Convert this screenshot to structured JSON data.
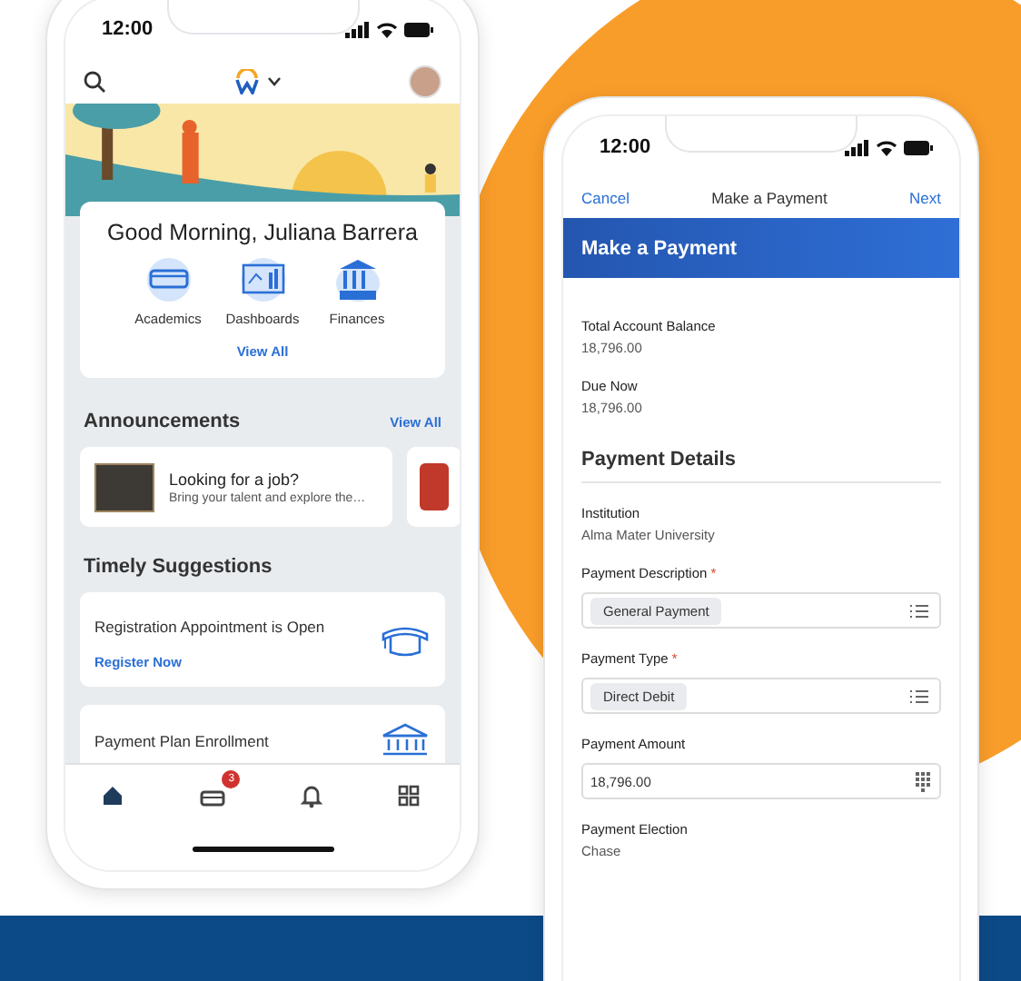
{
  "home_phone": {
    "status_time": "12:00",
    "greeting": "Good Morning, Juliana Barrera",
    "apps": [
      {
        "label": "Academics"
      },
      {
        "label": "Dashboards"
      },
      {
        "label": "Finances"
      }
    ],
    "apps_link": "View All",
    "announcements": {
      "title": "Announcements",
      "link": "View All",
      "cards": [
        {
          "title": "Looking for a job?",
          "text": "Bring your talent and explore the…"
        }
      ]
    },
    "suggestions": {
      "title": "Timely Suggestions",
      "cards": [
        {
          "title": "Registration Appointment is Open",
          "link": "Register Now"
        },
        {
          "title": "Payment Plan Enrollment"
        }
      ]
    },
    "tab_bar": [
      {
        "selected": true
      },
      {
        "selected": false,
        "badge": "3"
      },
      {
        "selected": false
      },
      {
        "selected": false
      }
    ]
  },
  "payment_phone": {
    "status_time": "12:00",
    "nav": {
      "cancel": "Cancel",
      "title": "Make a Payment",
      "next": "Next"
    },
    "banner": "Make a Payment",
    "fields": [
      {
        "kind": "text",
        "label": "Total Account Balance",
        "value": "18,796.00"
      },
      {
        "kind": "text",
        "label": "Due Now",
        "value": "18,796.00"
      },
      {
        "kind": "section",
        "label": "Payment Details"
      },
      {
        "kind": "text",
        "label": "Institution",
        "value": "Alma Mater University"
      },
      {
        "kind": "select",
        "label": "Payment Description",
        "required": true,
        "required_mark": "*",
        "value": "General Payment"
      },
      {
        "kind": "select",
        "label": "Payment Type",
        "required": true,
        "required_mark": "*",
        "value": "Direct Debit"
      },
      {
        "kind": "number",
        "label": "Payment Amount",
        "value": "18,796.00"
      },
      {
        "kind": "text",
        "label": "Payment Election",
        "value": "Chase"
      }
    ]
  }
}
